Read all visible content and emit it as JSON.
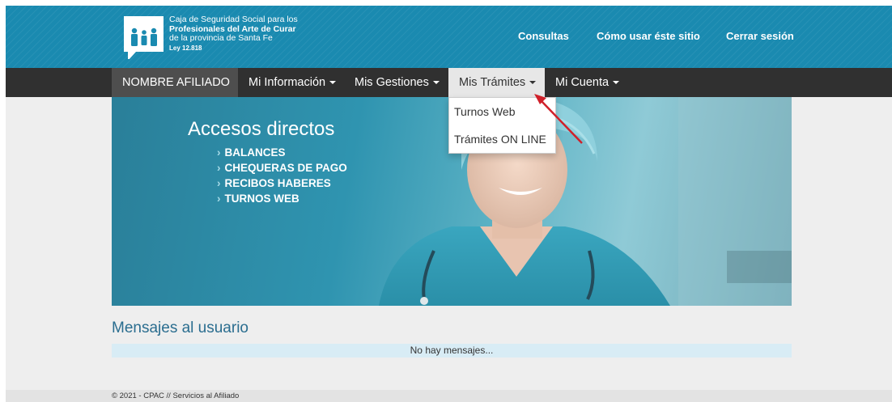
{
  "logo": {
    "line1": "Caja de Seguridad Social para los",
    "line2": "Profesionales del Arte de Curar",
    "line3": "de la provincia de Santa Fe",
    "line4": "Ley 12.818"
  },
  "topnav": {
    "consultas": "Consultas",
    "como_usar": "Cómo usar éste sitio",
    "cerrar_sesion": "Cerrar sesión"
  },
  "navbar": {
    "name": "NOMBRE AFILIADO",
    "items": [
      {
        "label": "Mi Información"
      },
      {
        "label": "Mis Gestiones"
      },
      {
        "label": "Mis Trámites"
      },
      {
        "label": "Mi Cuenta"
      }
    ]
  },
  "dropdown": {
    "items": [
      {
        "label": "Turnos Web"
      },
      {
        "label": "Trámites ON LINE"
      }
    ]
  },
  "banner": {
    "title": "Accesos directos",
    "links": [
      {
        "label": "BALANCES"
      },
      {
        "label": "CHEQUERAS DE PAGO"
      },
      {
        "label": "RECIBOS HABERES"
      },
      {
        "label": "TURNOS WEB"
      }
    ]
  },
  "messages": {
    "title": "Mensajes al usuario",
    "empty": "No hay mensajes..."
  },
  "footer": {
    "text": "© 2021 - CPAC // Servicios al Afiliado"
  },
  "colors": {
    "header": "#1a8ab0",
    "navbar": "#303030",
    "annotation_arrow": "#d0202a",
    "message_box": "#d8ecf5"
  }
}
